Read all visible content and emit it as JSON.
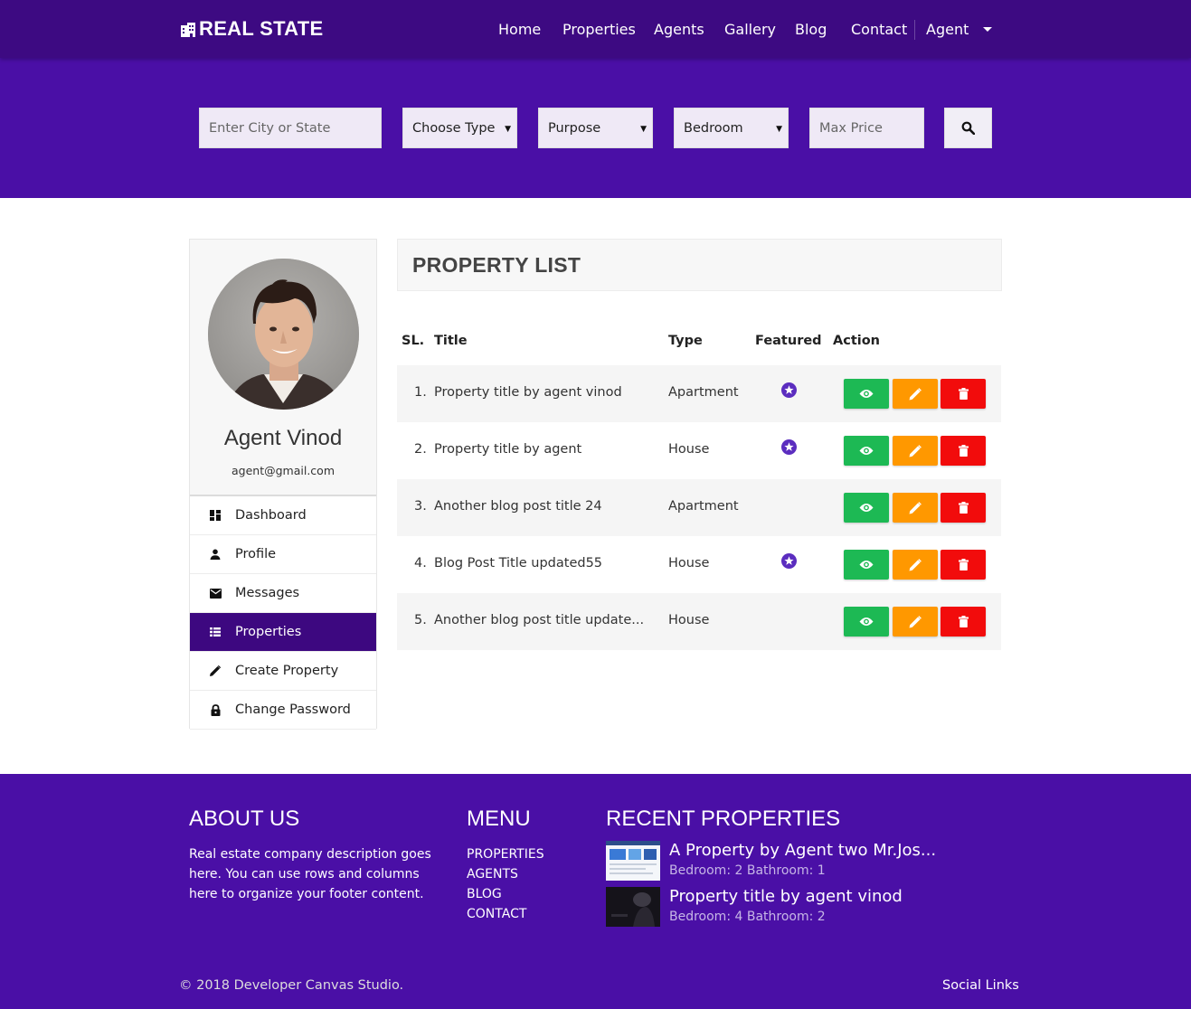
{
  "brand": {
    "name": "REAL STATE",
    "icon": "building-icon"
  },
  "nav": {
    "items": [
      {
        "label": "Home"
      },
      {
        "label": "Properties"
      },
      {
        "label": "Agents"
      },
      {
        "label": "Gallery"
      },
      {
        "label": "Blog"
      },
      {
        "label": "Contact"
      }
    ],
    "account_label": "Agent"
  },
  "search": {
    "city_placeholder": "Enter City or State",
    "type_value": "Choose Type",
    "purpose_value": "Purpose",
    "bedroom_value": "Bedroom",
    "max_price_placeholder": "Max Price",
    "button_icon": "search-icon"
  },
  "sidebar": {
    "agent_name": "Agent Vinod",
    "agent_email": "agent@gmail.com",
    "menu": [
      {
        "label": "Dashboard",
        "icon": "dashboard-icon",
        "active": false
      },
      {
        "label": "Profile",
        "icon": "person-icon",
        "active": false
      },
      {
        "label": "Messages",
        "icon": "mail-icon",
        "active": false
      },
      {
        "label": "Properties",
        "icon": "list-icon",
        "active": true
      },
      {
        "label": "Create Property",
        "icon": "pencil-icon",
        "active": false
      },
      {
        "label": "Change Password",
        "icon": "lock-icon",
        "active": false
      }
    ]
  },
  "main": {
    "title": "PROPERTY LIST",
    "columns": {
      "sl": "SL.",
      "title": "Title",
      "type": "Type",
      "featured": "Featured",
      "action": "Action"
    },
    "rows": [
      {
        "sl": "1.",
        "title": "Property title by agent vinod",
        "type": "Apartment",
        "featured": true
      },
      {
        "sl": "2.",
        "title": "Property title by agent",
        "type": "House",
        "featured": true
      },
      {
        "sl": "3.",
        "title": "Another blog post title 24",
        "type": "Apartment",
        "featured": false
      },
      {
        "sl": "4.",
        "title": "Blog Post Title updated55",
        "type": "House",
        "featured": true
      },
      {
        "sl": "5.",
        "title": "Another blog post title update...",
        "type": "House",
        "featured": false
      }
    ]
  },
  "footer": {
    "about_title": "ABOUT US",
    "about_text": "Real estate company description goes here. You can use rows and columns here to organize your footer content.",
    "menu_title": "MENU",
    "menu_items": [
      "PROPERTIES",
      "AGENTS",
      "BLOG",
      "CONTACT"
    ],
    "recent_title": "RECENT PROPERTIES",
    "recent": [
      {
        "title": "A Property by Agent two Mr.Jos...",
        "meta": "Bedroom: 2 Bathroom: 1"
      },
      {
        "title": "Property title by agent vinod",
        "meta": "Bedroom: 4 Bathroom: 2"
      }
    ],
    "copyright": "© 2018 Developer Canvas Studio.",
    "social": "Social Links"
  },
  "colors": {
    "nav_bg": "#3d0a82",
    "band_bg": "#4a0fa6",
    "active_menu": "#3d0880",
    "view_btn": "#1db954",
    "edit_btn": "#ff9800",
    "delete_btn": "#f20c0c",
    "star": "#5b2dbf"
  }
}
